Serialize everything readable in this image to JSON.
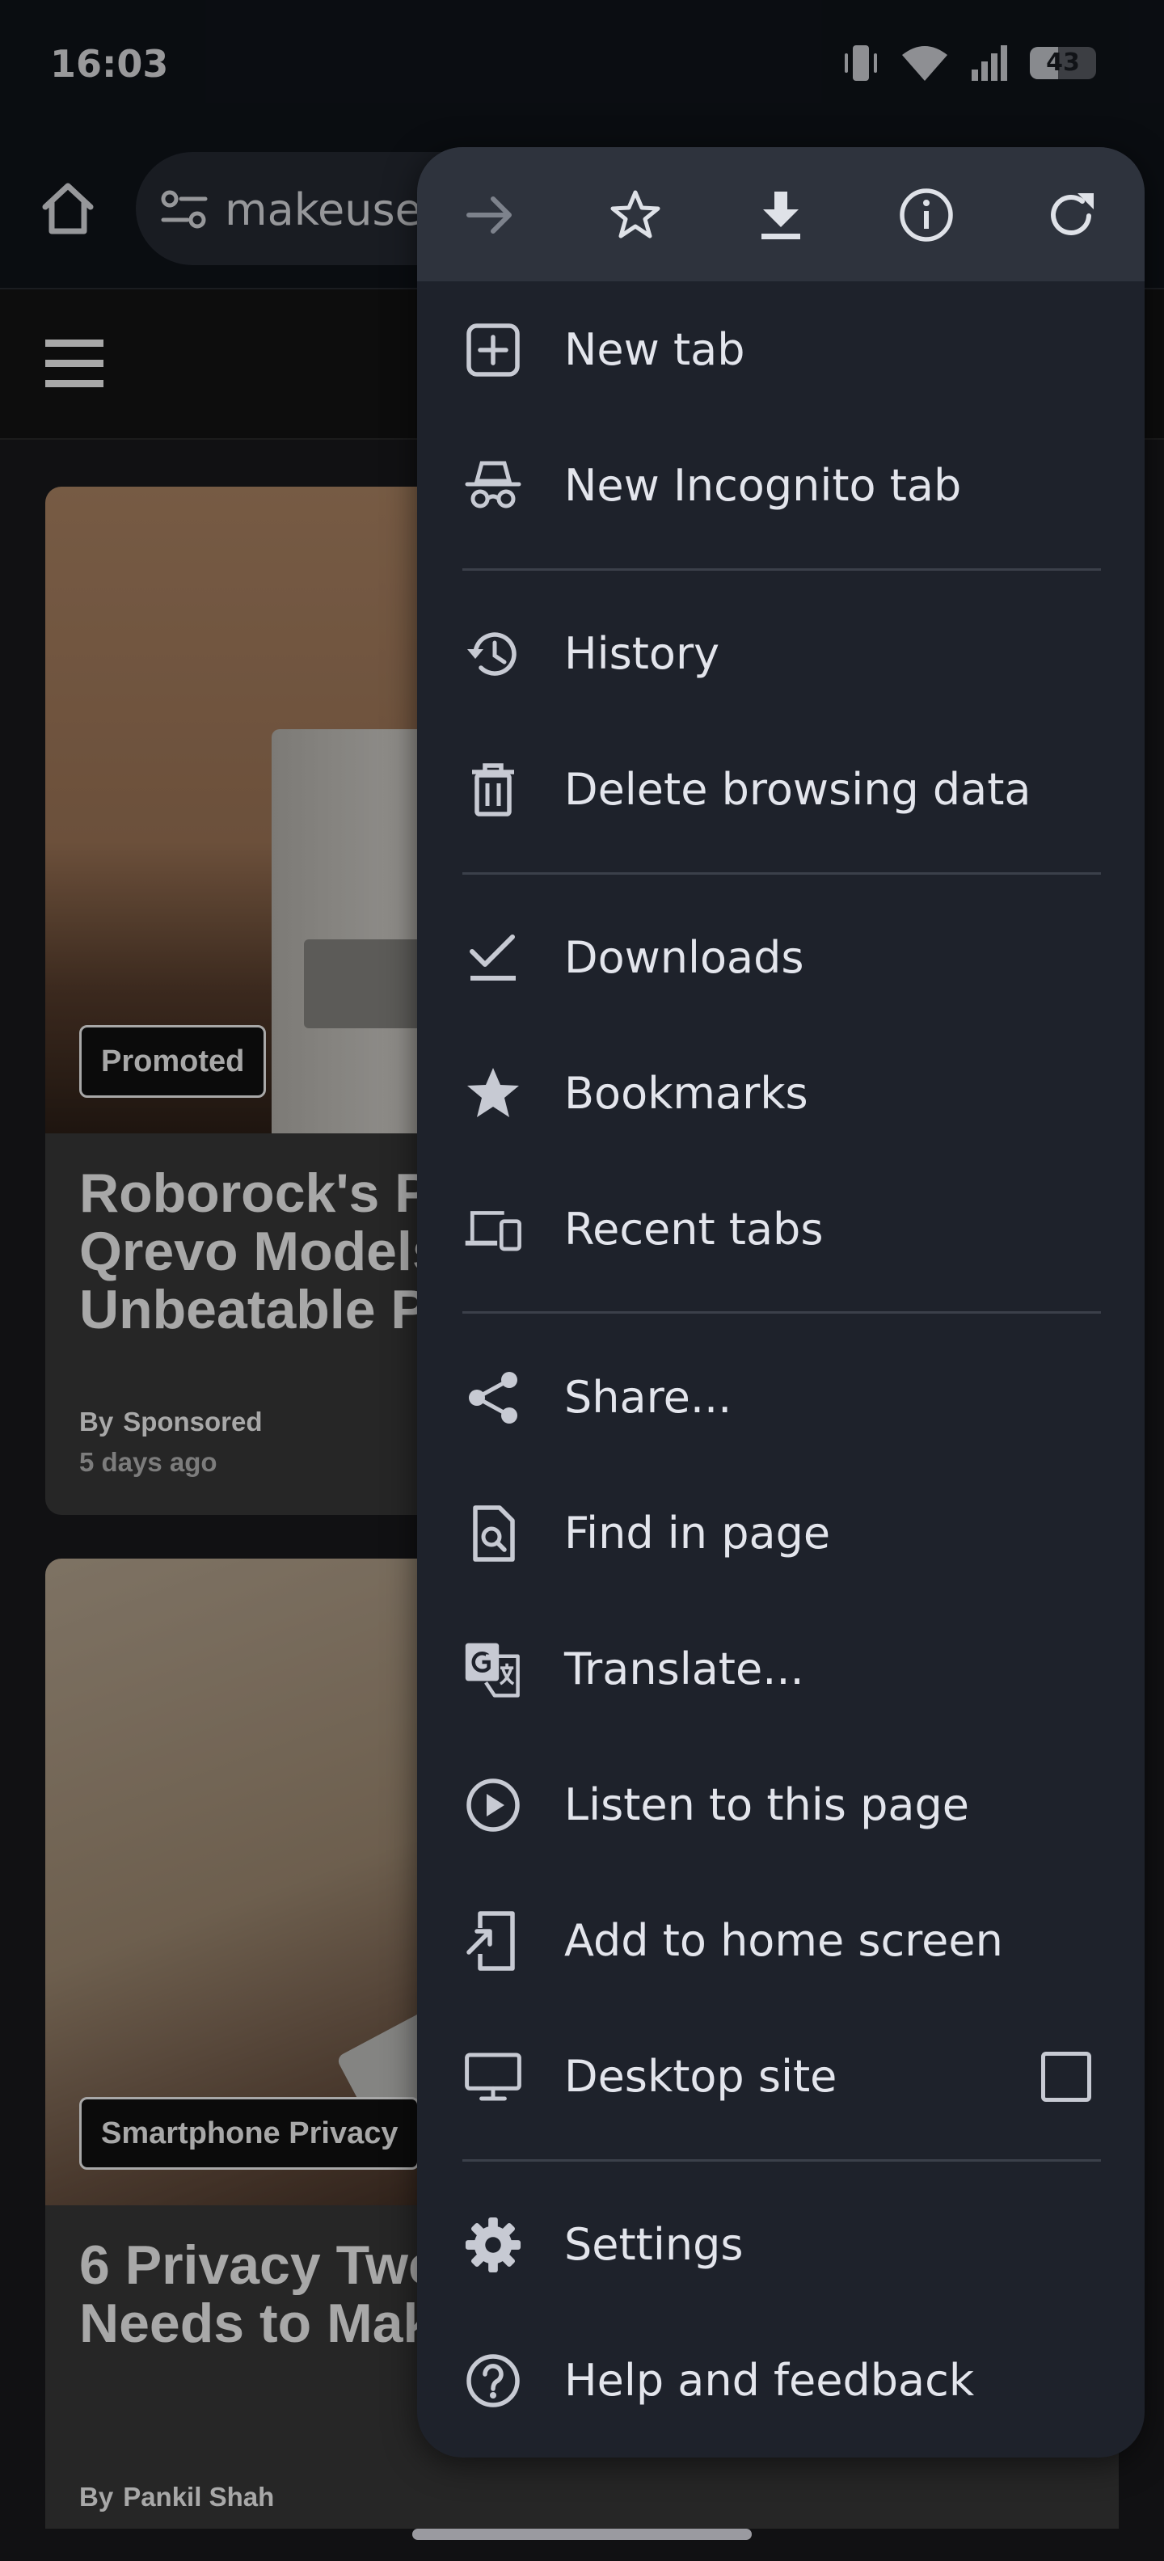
{
  "status_bar": {
    "time": "16:03",
    "battery_level": "43",
    "icons": [
      "vibrate-icon",
      "wifi-icon",
      "signal-icon",
      "battery-icon"
    ]
  },
  "browser": {
    "url_display": "makeusec",
    "actions": [
      "forward-icon",
      "bookmark-star-icon",
      "download-icon",
      "page-info-icon",
      "refresh-icon"
    ]
  },
  "site": {
    "articles": [
      {
        "tag": "Promoted",
        "title_lines": [
          "Roborock's Pr",
          "Qrevo Models",
          "Unbeatable P"
        ],
        "by": "By",
        "author": "Sponsored",
        "time": "5 days ago"
      },
      {
        "tag": "Smartphone Privacy",
        "title_lines": [
          "6 Privacy Twe",
          "Needs to Mak"
        ],
        "by": "By",
        "author": "Pankil Shah"
      }
    ]
  },
  "menu": {
    "items": [
      {
        "label": "New tab",
        "icon": "new-tab-icon"
      },
      {
        "label": "New Incognito tab",
        "icon": "incognito-icon"
      },
      {
        "label": "History",
        "icon": "history-icon"
      },
      {
        "label": "Delete browsing data",
        "icon": "trash-icon"
      },
      {
        "label": "Downloads",
        "icon": "downloads-icon"
      },
      {
        "label": "Bookmarks",
        "icon": "bookmarks-icon"
      },
      {
        "label": "Recent tabs",
        "icon": "recent-tabs-icon"
      },
      {
        "label": "Share...",
        "icon": "share-icon"
      },
      {
        "label": "Find in page",
        "icon": "find-in-page-icon"
      },
      {
        "label": "Translate...",
        "icon": "translate-icon"
      },
      {
        "label": "Listen to this page",
        "icon": "listen-icon"
      },
      {
        "label": "Add to home screen",
        "icon": "add-to-home-icon"
      },
      {
        "label": "Desktop site",
        "icon": "desktop-icon",
        "checked": false
      },
      {
        "label": "Settings",
        "icon": "gear-icon"
      },
      {
        "label": "Help and feedback",
        "icon": "help-icon"
      }
    ]
  },
  "colors": {
    "menu_bg": "#1e222b",
    "menu_action_bg": "#2e333d",
    "icon": "#c7cad3",
    "text": "#e3e5ec"
  }
}
